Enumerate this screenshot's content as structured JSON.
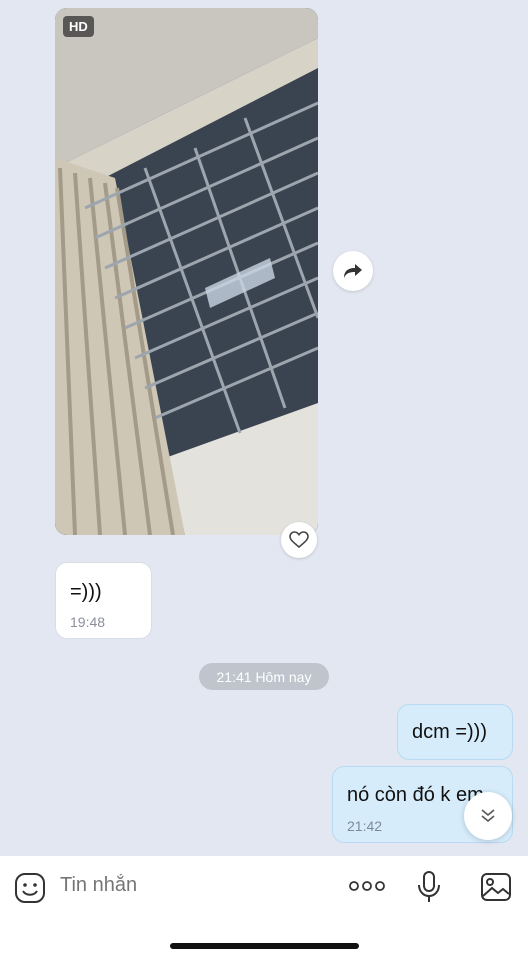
{
  "media": {
    "quality_badge": "HD",
    "share_icon": "share-arrow-icon",
    "like_icon": "heart-icon"
  },
  "messages": [
    {
      "direction": "incoming",
      "text": "=)))",
      "time": "19:48"
    },
    {
      "direction": "outgoing",
      "text": "dcm =)))",
      "time": ""
    },
    {
      "direction": "outgoing",
      "text": "nó còn đó k em",
      "time": "21:42"
    }
  ],
  "date_separator": "21:41 Hôm nay",
  "composer": {
    "placeholder": "Tin nhắn",
    "emoji_icon": "sticker-icon",
    "more_icon": "more-dots-icon",
    "mic_icon": "microphone-icon",
    "gallery_icon": "image-gallery-icon"
  },
  "colors": {
    "background": "#e3e7f1",
    "outgoing_bubble": "#d6ecfb",
    "incoming_bubble": "#ffffff"
  }
}
